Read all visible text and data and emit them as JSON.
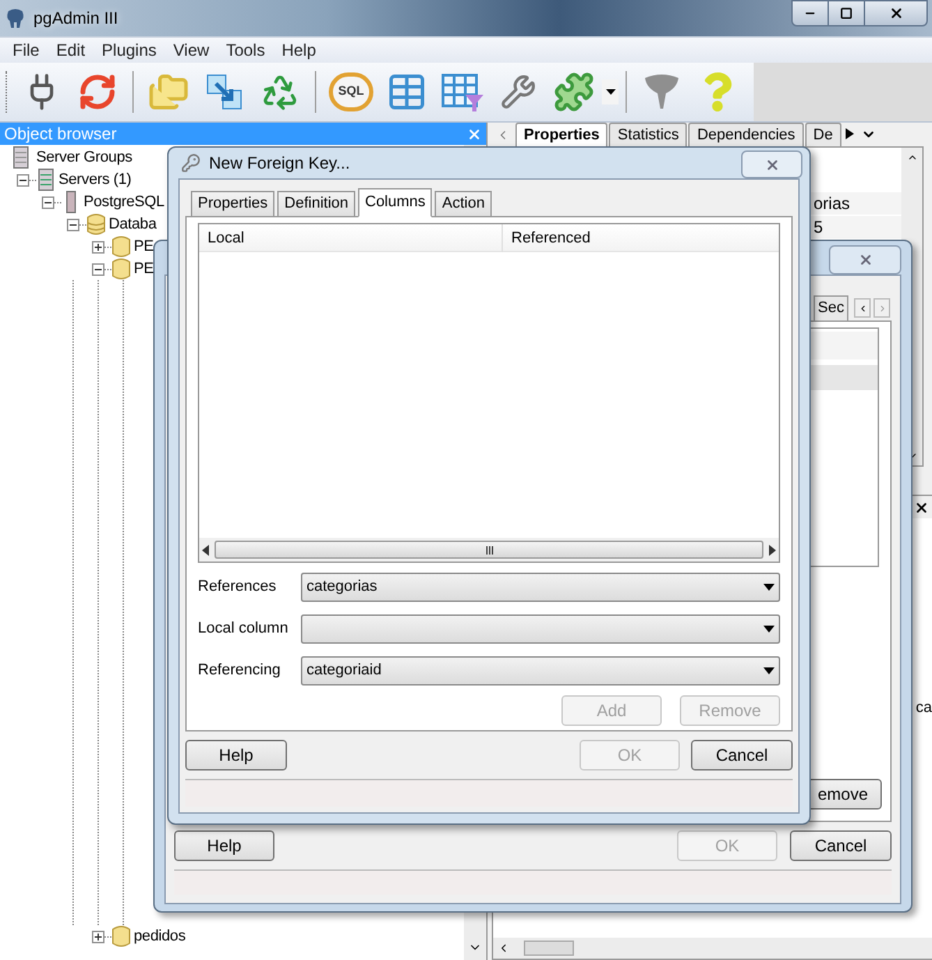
{
  "main_window": {
    "title": "pgAdmin III"
  },
  "menu": [
    "File",
    "Edit",
    "Plugins",
    "View",
    "Tools",
    "Help"
  ],
  "toolbar": [
    {
      "kind": "plug",
      "disabled": false
    },
    {
      "kind": "refresh",
      "disabled": false
    },
    {
      "kind": "separator"
    },
    {
      "kind": "folders",
      "disabled": false
    },
    {
      "kind": "transfer",
      "disabled": false
    },
    {
      "kind": "recycle",
      "disabled": false
    },
    {
      "kind": "separator"
    },
    {
      "kind": "sql",
      "label": "SQL",
      "disabled": false
    },
    {
      "kind": "table",
      "disabled": false
    },
    {
      "kind": "filter-table",
      "disabled": false
    },
    {
      "kind": "wrench",
      "disabled": false
    },
    {
      "kind": "puzzle",
      "disabled": false
    },
    {
      "kind": "dropdown",
      "disabled": false
    },
    {
      "kind": "separator"
    },
    {
      "kind": "funnel",
      "disabled": true
    },
    {
      "kind": "help",
      "disabled": false
    }
  ],
  "object_browser": {
    "title": "Object browser",
    "tree": [
      {
        "label": "Server Groups",
        "kind": "group",
        "children": [
          {
            "label": "Servers (1)",
            "kind": "servers",
            "expanded": true,
            "children": [
              {
                "label": "PostgreSQL",
                "kind": "server",
                "expanded": true,
                "children": [
                  {
                    "label": "Databa",
                    "kind": "databases",
                    "expanded": true,
                    "children": [
                      {
                        "label": "PE",
                        "kind": "database",
                        "expanded": false
                      },
                      {
                        "label": "PE",
                        "kind": "database",
                        "expanded": true
                      },
                      {
                        "label": "pedidos",
                        "kind": "database",
                        "expanded": false
                      }
                    ]
                  }
                ]
              }
            ]
          }
        ]
      }
    ]
  },
  "properties_panel": {
    "tabs": [
      {
        "label": "Properties",
        "selected": true
      },
      {
        "label": "Statistics",
        "selected": false
      },
      {
        "label": "Dependencies",
        "selected": false
      },
      {
        "label": "De",
        "selected": false
      }
    ],
    "values": [
      "orias",
      "5"
    ],
    "lower_text": "ca"
  },
  "back_dialog": {
    "tabs": [
      {
        "label": "Sec",
        "selected": false
      }
    ],
    "remove_button": "emove",
    "buttons": [
      {
        "label": "Help",
        "disabled": false
      },
      {
        "label": "OK",
        "disabled": true
      },
      {
        "label": "Cancel",
        "disabled": false
      }
    ]
  },
  "dialog": {
    "title": "New Foreign Key...",
    "tabs": [
      {
        "label": "Properties",
        "selected": false
      },
      {
        "label": "Definition",
        "selected": false
      },
      {
        "label": "Columns",
        "selected": true
      },
      {
        "label": "Action",
        "selected": false
      }
    ],
    "columns_list": {
      "columns": [
        "Local",
        "Referenced"
      ]
    },
    "fields": [
      {
        "label": "References",
        "value": "categorias"
      },
      {
        "label": "Local column"
      },
      {
        "label": "Referencing",
        "value": "categoriaid"
      }
    ],
    "list_buttons": [
      {
        "label": "Add",
        "disabled": true
      },
      {
        "label": "Remove",
        "disabled": true
      }
    ],
    "buttons": [
      {
        "label": "Help",
        "disabled": false
      },
      {
        "label": "OK",
        "disabled": true
      },
      {
        "label": "Cancel",
        "disabled": false
      }
    ]
  }
}
